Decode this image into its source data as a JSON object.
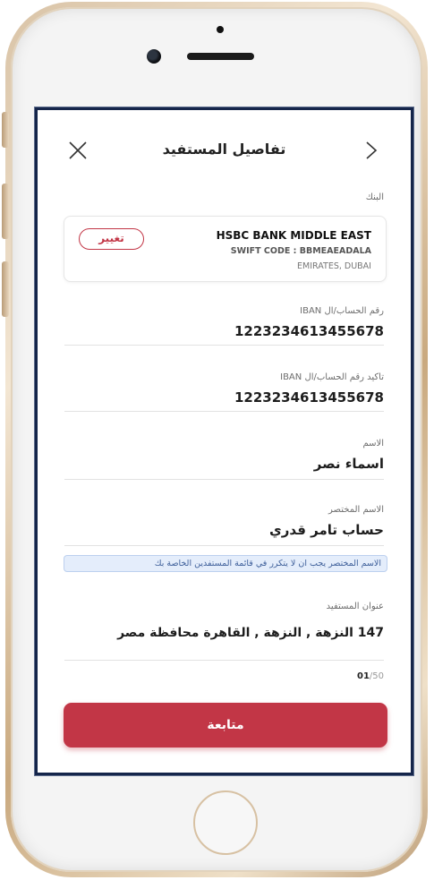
{
  "header": {
    "title": "تفاصيل المستفيد",
    "close_icon": "close-icon",
    "back_icon": "chevron-right-icon"
  },
  "bank": {
    "label": "البنك",
    "name": "HSBC BANK MIDDLE EAST",
    "swift": "SWIFT CODE : BBMEAEADALA",
    "location": "EMIRATES, DUBAI",
    "change_label": "تغيير"
  },
  "fields": {
    "iban": {
      "label": "رقم الحساب/ال IBAN",
      "value": "1223234613455678"
    },
    "iban_confirm": {
      "label": "تاكيد رقم الحساب/ال IBAN",
      "value": "1223234613455678"
    },
    "name": {
      "label": "الاسم",
      "value": "اسماء نصر"
    },
    "nickname": {
      "label": "الاسم المختصر",
      "value": "حساب تامر قدري",
      "hint": "الاسم المختصر يجب ان لا يتكرر في قائمة المستفدين الخاصة بك"
    },
    "address": {
      "label": "عنوان المستفيد",
      "value": "147 النزهة , النزهة , القاهرة محافظة مصر",
      "count_current": "01",
      "count_max": "/50"
    }
  },
  "continue_label": "متابعة",
  "colors": {
    "accent": "#c23646",
    "hint_bg": "#e4edfb",
    "frame": "#15254a"
  }
}
